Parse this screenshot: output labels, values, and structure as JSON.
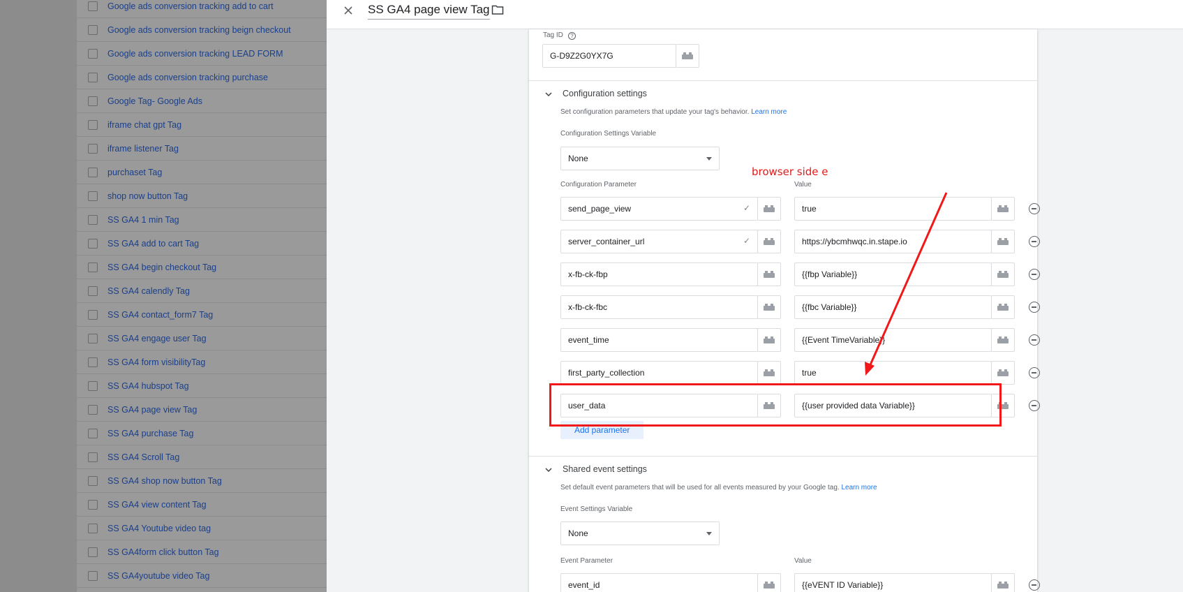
{
  "tag_list": [
    "Google ads conversion tracking add to cart",
    "Google ads conversion tracking beign checkout",
    "Google ads conversion tracking LEAD FORM",
    "Google ads conversion tracking purchase",
    "Google Tag- Google Ads",
    "iframe chat gpt Tag",
    "iframe listener Tag",
    "purchaset Tag",
    "shop now button Tag",
    "SS GA4 1 min Tag",
    "SS GA4 add to cart Tag",
    "SS GA4 begin checkout Tag",
    "SS GA4 calendly Tag",
    "SS GA4 contact_form7 Tag",
    "SS GA4 engage user Tag",
    "SS GA4 form visibilityTag",
    "SS GA4 hubspot Tag",
    "SS GA4 page view Tag",
    "SS GA4 purchase Tag",
    "SS GA4 Scroll Tag",
    "SS GA4 shop now button Tag",
    "SS GA4 view content Tag",
    "SS GA4 Youtube video tag",
    "SS GA4form click button Tag",
    "SS GA4youtube video Tag"
  ],
  "drawer": {
    "title": "SS GA4 page view Tag",
    "close_icon": "close-icon",
    "folder_icon": "folder-icon"
  },
  "tag_id": {
    "label": "Tag ID",
    "help": "?",
    "value": "G-D9Z2G0YX7G"
  },
  "config_section": {
    "title": "Configuration settings",
    "description": "Set configuration parameters that update your tag's behavior.",
    "learn_more": "Learn more",
    "settings_variable_label": "Configuration Settings Variable",
    "settings_variable_value": "None",
    "param_header": "Configuration Parameter",
    "value_header": "Value",
    "rows": [
      {
        "param": "send_page_view",
        "value": "true",
        "validated": true
      },
      {
        "param": "server_container_url",
        "value": "https://ybcmhwqc.in.stape.io",
        "validated": true
      },
      {
        "param": "x-fb-ck-fbp",
        "value": "{{fbp Variable}}",
        "validated": false
      },
      {
        "param": "x-fb-ck-fbc",
        "value": "{{fbc Variable}}",
        "validated": false
      },
      {
        "param": "event_time",
        "value": "{{Event TimeVariable}}",
        "validated": false
      },
      {
        "param": "first_party_collection",
        "value": "true",
        "validated": false
      },
      {
        "param": "user_data",
        "value": "{{user provided data Variable}}",
        "validated": false
      }
    ],
    "check_mark": "✓",
    "add_parameter": "Add parameter"
  },
  "shared_section": {
    "title": "Shared event settings",
    "description": "Set default event parameters that will be used for all events measured by your Google tag.",
    "learn_more": "Learn more",
    "settings_variable_label": "Event Settings Variable",
    "settings_variable_value": "None",
    "param_header": "Event Parameter",
    "value_header": "Value",
    "rows": [
      {
        "param": "event_id",
        "value": "{{eVENT ID Variable}}"
      }
    ]
  },
  "annotation": {
    "text": "browser side e",
    "color": "#e81919"
  }
}
